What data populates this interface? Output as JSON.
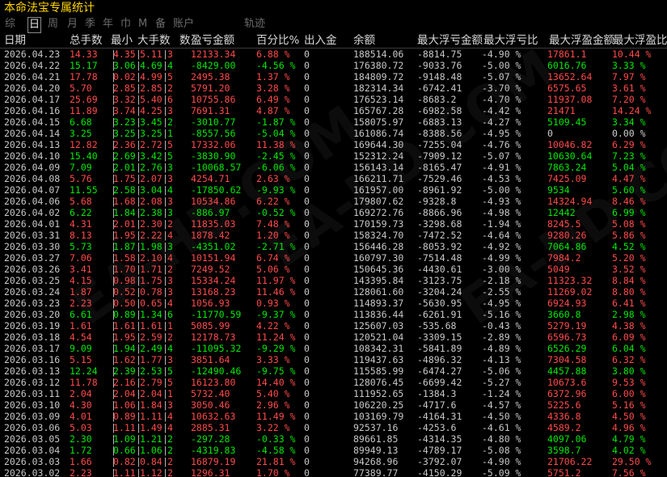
{
  "title": "本命法宝专属统计",
  "tabs": [
    {
      "label": "综",
      "active": false
    },
    {
      "label": "日",
      "active": true
    },
    {
      "label": "周",
      "active": false
    },
    {
      "label": "月",
      "active": false
    },
    {
      "label": "季",
      "active": false
    },
    {
      "label": "年",
      "active": false
    },
    {
      "label": "巾",
      "active": false
    },
    {
      "label": "M",
      "active": false
    },
    {
      "label": "备",
      "active": false
    },
    {
      "label": "账户",
      "active": false
    },
    {
      "label": "轨迹",
      "active": false
    }
  ],
  "columns": {
    "date": "日期",
    "total": "总手数",
    "min": "最小",
    "max": "大手数",
    "count": "数",
    "profit": "盈亏金额",
    "pct": "百分比%",
    "io": "出入金",
    "balance": "余额",
    "max_float_loss_amt": "最大浮亏金额",
    "max_float_loss_ratio": "最大浮亏比",
    "max_float_gain_amt": "最大浮盈金额",
    "max_float_gain_ratio": "最大浮盈比"
  },
  "watermark": "EA-HD.COM",
  "rows": [
    {
      "date": "2026.04.23",
      "total": "14.33",
      "min": "4.35",
      "max": "5.11",
      "count": "3",
      "profit": "12133.34",
      "pct": "6.88 %",
      "io": "0",
      "balance": "188514.06",
      "mfa": "-8814.75",
      "mfr": "-4.90 %",
      "mga": "17861.1",
      "mgr": "10.44 %",
      "s": "red"
    },
    {
      "date": "2026.04.22",
      "total": "15.17",
      "min": "3.06",
      "max": "4.69",
      "count": "4",
      "profit": "-8429.00",
      "pct": "-4.56 %",
      "io": "0",
      "balance": "176380.72",
      "mfa": "-9033.76",
      "mfr": "-5.00 %",
      "mga": "6016.76",
      "mgr": "3.33 %",
      "s": "green"
    },
    {
      "date": "2026.04.21",
      "total": "17.78",
      "min": "0.02",
      "max": "4.99",
      "count": "5",
      "profit": "2495.38",
      "pct": "1.37 %",
      "io": "0",
      "balance": "184809.72",
      "mfa": "-9148.48",
      "mfr": "-5.07 %",
      "mga": "13652.64",
      "mgr": "7.97 %",
      "s": "red"
    },
    {
      "date": "2026.04.20",
      "total": "5.70",
      "min": "2.85",
      "max": "2.85",
      "count": "2",
      "profit": "5791.20",
      "pct": "3.28 %",
      "io": "0",
      "balance": "182314.34",
      "mfa": "-6742.41",
      "mfr": "-3.70 %",
      "mga": "6575.65",
      "mgr": "3.61 %",
      "s": "red"
    },
    {
      "date": "2026.04.17",
      "total": "25.69",
      "min": "3.32",
      "max": "5.40",
      "count": "6",
      "profit": "10755.86",
      "pct": "6.49 %",
      "io": "0",
      "balance": "176523.14",
      "mfa": "-8683.2",
      "mfr": "-4.70 %",
      "mga": "11937.08",
      "mgr": "7.20 %",
      "s": "red"
    },
    {
      "date": "2026.04.16",
      "total": "11.89",
      "min": "3.74",
      "max": "4.25",
      "count": "3",
      "profit": "7691.31",
      "pct": "4.87 %",
      "io": "0",
      "balance": "165767.28",
      "mfa": "-6982.58",
      "mfr": "-4.42 %",
      "mga": "21471",
      "mgr": "14.24 %",
      "s": "red"
    },
    {
      "date": "2026.04.15",
      "total": "6.68",
      "min": "3.23",
      "max": "3.45",
      "count": "2",
      "profit": "-3010.77",
      "pct": "-1.87 %",
      "io": "0",
      "balance": "158075.97",
      "mfa": "-6883.13",
      "mfr": "-4.27 %",
      "mga": "5109.45",
      "mgr": "3.34 %",
      "s": "green"
    },
    {
      "date": "2026.04.14",
      "total": "3.25",
      "min": "3.25",
      "max": "3.25",
      "count": "1",
      "profit": "-8557.56",
      "pct": "-5.04 %",
      "io": "0",
      "balance": "161086.74",
      "mfa": "-8388.56",
      "mfr": "-4.95 %",
      "mga": "0",
      "mgr": "0.00 %",
      "s": "green",
      "gw": true
    },
    {
      "date": "2026.04.13",
      "total": "12.82",
      "min": "2.36",
      "max": "2.72",
      "count": "5",
      "profit": "17332.06",
      "pct": "11.38 %",
      "io": "0",
      "balance": "169644.30",
      "mfa": "-7255.04",
      "mfr": "-4.76 %",
      "mga": "10046.82",
      "mgr": "6.29 %",
      "s": "red"
    },
    {
      "date": "2026.04.10",
      "total": "15.40",
      "min": "2.69",
      "max": "3.42",
      "count": "5",
      "profit": "-3830.90",
      "pct": "-2.45 %",
      "io": "0",
      "balance": "152312.24",
      "mfa": "-7909.12",
      "mfr": "-5.07 %",
      "mga": "10630.64",
      "mgr": "7.23 %",
      "s": "green"
    },
    {
      "date": "2026.04.09",
      "total": "7.09",
      "min": "2.01",
      "max": "2.76",
      "count": "3",
      "profit": "-10068.57",
      "pct": "-6.06 %",
      "io": "0",
      "balance": "156143.14",
      "mfa": "-8165.47",
      "mfr": "-4.91 %",
      "mga": "7863.24",
      "mgr": "5.04 %",
      "s": "green"
    },
    {
      "date": "2026.04.08",
      "total": "5.76",
      "min": "1.75",
      "max": "2.07",
      "count": "3",
      "profit": "4254.71",
      "pct": "2.63 %",
      "io": "0",
      "balance": "166211.71",
      "mfa": "-7529.46",
      "mfr": "-4.53 %",
      "mga": "7425.09",
      "mgr": "4.47 %",
      "s": "red"
    },
    {
      "date": "2026.04.07",
      "total": "11.55",
      "min": "2.58",
      "max": "3.04",
      "count": "4",
      "profit": "-17850.62",
      "pct": "-9.93 %",
      "io": "0",
      "balance": "161957.00",
      "mfa": "-8961.92",
      "mfr": "-5.00 %",
      "mga": "9534",
      "mgr": "5.60 %",
      "s": "green"
    },
    {
      "date": "2026.04.06",
      "total": "5.68",
      "min": "1.68",
      "max": "2.08",
      "count": "3",
      "profit": "10534.86",
      "pct": "6.22 %",
      "io": "0",
      "balance": "179807.62",
      "mfa": "-9328.8",
      "mfr": "-4.93 %",
      "mga": "14324.94",
      "mgr": "8.46 %",
      "s": "red"
    },
    {
      "date": "2026.04.02",
      "total": "6.22",
      "min": "1.84",
      "max": "2.38",
      "count": "3",
      "profit": "-886.97",
      "pct": "-0.52 %",
      "io": "0",
      "balance": "169272.76",
      "mfa": "-8866.96",
      "mfr": "-4.98 %",
      "mga": "12442",
      "mgr": "6.99 %",
      "s": "green"
    },
    {
      "date": "2026.04.01",
      "total": "4.31",
      "min": "2.01",
      "max": "2.30",
      "count": "2",
      "profit": "11835.03",
      "pct": "7.48 %",
      "io": "0",
      "balance": "170159.73",
      "mfa": "-3298.68",
      "mfr": "-1.94 %",
      "mga": "8245.5",
      "mgr": "5.08 %",
      "s": "red"
    },
    {
      "date": "2026.03.31",
      "total": "8.13",
      "min": "1.95",
      "max": "2.22",
      "count": "4",
      "profit": "1878.42",
      "pct": "1.20 %",
      "io": "0",
      "balance": "158324.70",
      "mfa": "-7472.52",
      "mfr": "-4.64 %",
      "mga": "9280.26",
      "mgr": "5.86 %",
      "s": "red"
    },
    {
      "date": "2026.03.30",
      "total": "5.73",
      "min": "1.87",
      "max": "1.98",
      "count": "3",
      "profit": "-4351.02",
      "pct": "-2.71 %",
      "io": "0",
      "balance": "156446.28",
      "mfa": "-8053.92",
      "mfr": "-4.92 %",
      "mga": "7064.86",
      "mgr": "4.52 %",
      "s": "green"
    },
    {
      "date": "2026.03.27",
      "total": "7.06",
      "min": "1.58",
      "max": "2.10",
      "count": "4",
      "profit": "10151.94",
      "pct": "6.74 %",
      "io": "0",
      "balance": "160797.30",
      "mfa": "-7514.48",
      "mfr": "-4.99 %",
      "mga": "7984.2",
      "mgr": "5.20 %",
      "s": "red"
    },
    {
      "date": "2026.03.26",
      "total": "3.41",
      "min": "1.70",
      "max": "1.71",
      "count": "2",
      "profit": "7249.52",
      "pct": "5.06 %",
      "io": "0",
      "balance": "150645.36",
      "mfa": "-4430.61",
      "mfr": "-3.00 %",
      "mga": "5049",
      "mgr": "3.52 %",
      "s": "red"
    },
    {
      "date": "2026.03.25",
      "total": "4.15",
      "min": "0.98",
      "max": "1.75",
      "count": "3",
      "profit": "15334.24",
      "pct": "11.97 %",
      "io": "0",
      "balance": "143395.84",
      "mfa": "-3123.75",
      "mfr": "-2.18 %",
      "mga": "11323.32",
      "mgr": "8.84 %",
      "s": "red"
    },
    {
      "date": "2026.03.24",
      "total": "1.87",
      "min": "0.52",
      "max": "0.78",
      "count": "3",
      "profit": "13168.23",
      "pct": "11.46 %",
      "io": "0",
      "balance": "128061.60",
      "mfa": "-3204.24",
      "mfr": "-2.55 %",
      "mga": "11269.02",
      "mgr": "8.80 %",
      "s": "red"
    },
    {
      "date": "2026.03.23",
      "total": "2.23",
      "min": "0.50",
      "max": "0.65",
      "count": "4",
      "profit": "1056.93",
      "pct": "0.93 %",
      "io": "0",
      "balance": "114893.37",
      "mfa": "-5630.95",
      "mfr": "-4.95 %",
      "mga": "6924.93",
      "mgr": "6.41 %",
      "s": "red"
    },
    {
      "date": "2026.03.20",
      "total": "6.61",
      "min": "0.89",
      "max": "1.34",
      "count": "6",
      "profit": "-11770.59",
      "pct": "-9.37 %",
      "io": "0",
      "balance": "113836.44",
      "mfa": "-6261.91",
      "mfr": "-5.16 %",
      "mga": "3660.8",
      "mgr": "2.98 %",
      "s": "green"
    },
    {
      "date": "2026.03.19",
      "total": "1.61",
      "min": "1.61",
      "max": "1.61",
      "count": "1",
      "profit": "5085.99",
      "pct": "4.22 %",
      "io": "0",
      "balance": "125607.03",
      "mfa": "-535.68",
      "mfr": "-0.43 %",
      "mga": "5279.19",
      "mgr": "4.38 %",
      "s": "red"
    },
    {
      "date": "2026.03.18",
      "total": "4.54",
      "min": "1.95",
      "max": "2.59",
      "count": "2",
      "profit": "12178.73",
      "pct": "11.24 %",
      "io": "0",
      "balance": "120521.04",
      "mfa": "-3309.15",
      "mfr": "-2.89 %",
      "mga": "6596.73",
      "mgr": "6.09 %",
      "s": "red"
    },
    {
      "date": "2026.03.17",
      "total": "9.09",
      "min": "1.94",
      "max": "2.49",
      "count": "4",
      "profit": "-11095.32",
      "pct": "-9.29 %",
      "io": "0",
      "balance": "108342.31",
      "mfa": "-5841.89",
      "mfr": "-4.89 %",
      "mga": "6526.29",
      "mgr": "6.04 %",
      "s": "green"
    },
    {
      "date": "2026.03.16",
      "total": "5.15",
      "min": "1.62",
      "max": "1.77",
      "count": "3",
      "profit": "3851.64",
      "pct": "3.33 %",
      "io": "0",
      "balance": "119437.63",
      "mfa": "-4896.32",
      "mfr": "-4.13 %",
      "mga": "7304.58",
      "mgr": "6.32 %",
      "s": "red"
    },
    {
      "date": "2026.03.13",
      "total": "12.24",
      "min": "2.39",
      "max": "2.53",
      "count": "5",
      "profit": "-12490.46",
      "pct": "-9.75 %",
      "io": "0",
      "balance": "115585.99",
      "mfa": "-6474.27",
      "mfr": "-5.06 %",
      "mga": "4457.88",
      "mgr": "3.80 %",
      "s": "green"
    },
    {
      "date": "2026.03.12",
      "total": "11.78",
      "min": "2.16",
      "max": "2.79",
      "count": "5",
      "profit": "16123.80",
      "pct": "14.40 %",
      "io": "0",
      "balance": "128076.45",
      "mfa": "-6699.42",
      "mfr": "-5.27 %",
      "mga": "10673.6",
      "mgr": "9.53 %",
      "s": "red"
    },
    {
      "date": "2026.03.11",
      "total": "2.04",
      "min": "2.04",
      "max": "2.04",
      "count": "1",
      "profit": "5732.40",
      "pct": "5.40 %",
      "io": "0",
      "balance": "111952.65",
      "mfa": "-1384.3",
      "mfr": "-1.24 %",
      "mga": "6372.96",
      "mgr": "6.00 %",
      "s": "red"
    },
    {
      "date": "2026.03.10",
      "total": "4.30",
      "min": "1.06",
      "max": "1.84",
      "count": "3",
      "profit": "3050.46",
      "pct": "2.96 %",
      "io": "0",
      "balance": "106220.25",
      "mfa": "-4717.6",
      "mfr": "-4.57 %",
      "mga": "5225.6",
      "mgr": "5.16 %",
      "s": "red"
    },
    {
      "date": "2026.03.09",
      "total": "4.01",
      "min": "0.89",
      "max": "1.11",
      "count": "4",
      "profit": "10632.63",
      "pct": "11.49 %",
      "io": "0",
      "balance": "103169.79",
      "mfa": "-4164.31",
      "mfr": "-4.50 %",
      "mga": "4336.8",
      "mgr": "4.50 %",
      "s": "red"
    },
    {
      "date": "2026.03.06",
      "total": "5.03",
      "min": "1.11",
      "max": "1.49",
      "count": "4",
      "profit": "2885.31",
      "pct": "3.22 %",
      "io": "0",
      "balance": "92537.16",
      "mfa": "-4253.6",
      "mfr": "-4.61 %",
      "mga": "4589.2",
      "mgr": "4.96 %",
      "s": "red"
    },
    {
      "date": "2026.03.05",
      "total": "2.30",
      "min": "1.09",
      "max": "1.21",
      "count": "2",
      "profit": "-297.28",
      "pct": "-0.33 %",
      "io": "0",
      "balance": "89661.85",
      "mfa": "-4314.35",
      "mfr": "-4.80 %",
      "mga": "4097.06",
      "mgr": "4.79 %",
      "s": "green"
    },
    {
      "date": "2026.03.04",
      "total": "1.72",
      "min": "0.66",
      "max": "1.06",
      "count": "2",
      "profit": "-4319.83",
      "pct": "-4.58 %",
      "io": "0",
      "balance": "89949.13",
      "mfa": "-4789.17",
      "mfr": "-5.08 %",
      "mga": "3598.7",
      "mgr": "4.02 %",
      "s": "green"
    },
    {
      "date": "2026.03.03",
      "total": "1.66",
      "min": "0.82",
      "max": "0.84",
      "count": "2",
      "profit": "16879.19",
      "pct": "21.81 %",
      "io": "0",
      "balance": "94268.96",
      "mfa": "-3792.07",
      "mfr": "-4.90 %",
      "mga": "21706.22",
      "mgr": "29.50 %",
      "s": "red"
    },
    {
      "date": "2026.03.02",
      "total": "2.23",
      "min": "1.11",
      "max": "1.12",
      "count": "2",
      "profit": "1296.31",
      "pct": "1.70 %",
      "io": "0",
      "balance": "77389.77",
      "mfa": "-4150.29",
      "mfr": "-5.09 %",
      "mga": "5751.2",
      "mgr": "7.56 %",
      "s": "red"
    }
  ]
}
